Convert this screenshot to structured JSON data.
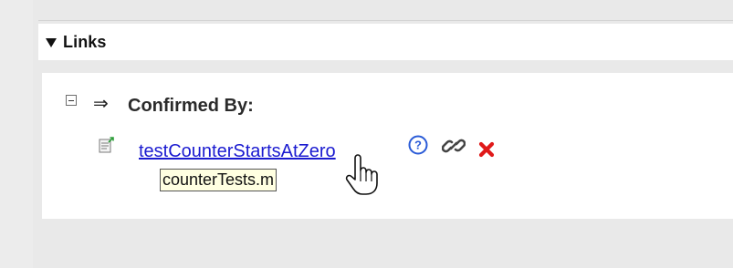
{
  "links_section": {
    "title": "Links",
    "expander_icon": "triangle-down-icon"
  },
  "confirmed_group": {
    "collapse_icon": "minus-box-icon",
    "direction_icon": "arrow-right-icon",
    "direction_symbol": "⇒",
    "label": "Confirmed By:"
  },
  "link_item": {
    "type_icon": "test-document-icon",
    "name": "testCounterStartsAtZero",
    "tooltip": "counterTests.m",
    "actions": [
      {
        "icon": "help-icon",
        "color": "#2a5bd7"
      },
      {
        "icon": "link-chain-icon",
        "color": "#444444"
      },
      {
        "icon": "delete-icon",
        "color": "#e01a1a"
      }
    ]
  },
  "cursor": {
    "icon": "hand-pointer-icon"
  }
}
